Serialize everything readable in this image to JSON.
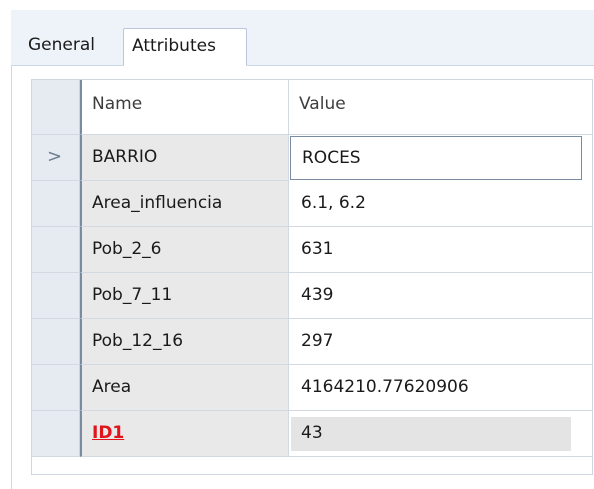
{
  "tabs": {
    "general": "General",
    "attributes": "Attributes"
  },
  "grid": {
    "header_name": "Name",
    "header_value": "Value",
    "current_row_indicator": ">",
    "rows": [
      {
        "name": "BARRIO",
        "value": "ROCES"
      },
      {
        "name": "Area_influencia",
        "value": "6.1, 6.2"
      },
      {
        "name": "Pob_2_6",
        "value": "631"
      },
      {
        "name": "Pob_7_11",
        "value": "439"
      },
      {
        "name": "Pob_12_16",
        "value": "297"
      },
      {
        "name": "Area",
        "value": "4164210.77620906"
      },
      {
        "name": "ID1",
        "value": "43"
      }
    ]
  },
  "colors": {
    "required_field": "#e0141b",
    "row_selector_bg": "#e6ebf2",
    "name_cell_bg": "#e9e9e9",
    "tab_strip_bg": "#eef3fa"
  }
}
